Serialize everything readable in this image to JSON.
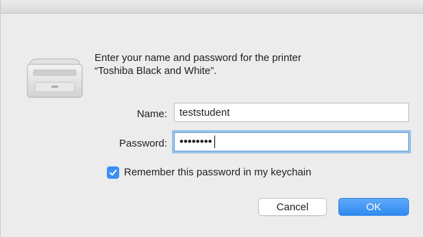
{
  "dialog": {
    "message_line1": "Enter your name and password for the printer",
    "message_line2": "“Toshiba Black and White”."
  },
  "form": {
    "name_label": "Name:",
    "name_value": "teststudent",
    "password_label": "Password:",
    "password_value": "••••••••",
    "remember_checked": true,
    "remember_label": "Remember this password in my keychain"
  },
  "buttons": {
    "cancel_label": "Cancel",
    "ok_label": "OK"
  },
  "colors": {
    "accent": "#3d8df4",
    "focus_ring": "#9cc2ea"
  },
  "icons": {
    "printer": "printer-icon",
    "checkbox": "checkmark-icon"
  }
}
